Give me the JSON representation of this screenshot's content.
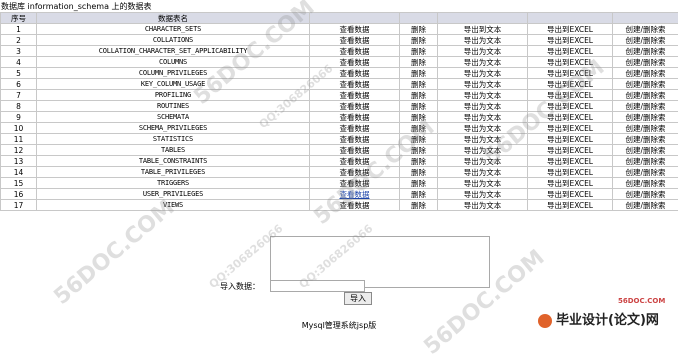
{
  "caption": "数据库 information_schema 上的数据表",
  "columns": [
    "序号",
    "数据表名",
    "",
    "",
    "",
    "",
    ""
  ],
  "actions": {
    "view": "查看数据",
    "delete": "删除",
    "export_text": "导出为文本",
    "export_excel": "导出到EXCEL",
    "create_delete": "创建/删除索"
  },
  "rows": [
    {
      "no": "1",
      "name": "CHARACTER_SETS",
      "export_text": "导出到文本",
      "export_excel": "导出到EXCEL"
    },
    {
      "no": "2",
      "name": "COLLATIONS",
      "export_text": "导出为文本",
      "export_excel": "导出到EXCEL"
    },
    {
      "no": "3",
      "name": "COLLATION_CHARACTER_SET_APPLICABILITY",
      "export_text": "导出为文本",
      "export_excel": "导出到EXCEL"
    },
    {
      "no": "4",
      "name": "COLUMNS",
      "export_text": "导出为文本",
      "export_excel": "导出到EXCEL"
    },
    {
      "no": "5",
      "name": "COLUMN_PRIVILEGES",
      "export_text": "导出为文本",
      "export_excel": "导出到EXCEL"
    },
    {
      "no": "6",
      "name": "KEY_COLUMN_USAGE",
      "export_text": "导出为文本",
      "export_excel": "导出到EXCEL"
    },
    {
      "no": "7",
      "name": "PROFILING",
      "export_text": "导出为文本",
      "export_excel": "导出到EXCEL"
    },
    {
      "no": "8",
      "name": "ROUTINES",
      "export_text": "导出为文本",
      "export_excel": "导出到EXCEL"
    },
    {
      "no": "9",
      "name": "SCHEMATA",
      "export_text": "导出为文本",
      "export_excel": "导出到EXCEL"
    },
    {
      "no": "10",
      "name": "SCHEMA_PRIVILEGES",
      "export_text": "导出为文本",
      "export_excel": "导出到EXCEL"
    },
    {
      "no": "11",
      "name": "STATISTICS",
      "export_text": "导出为文本",
      "export_excel": "导出到EXCEL"
    },
    {
      "no": "12",
      "name": "TABLES",
      "export_text": "导出为文本",
      "export_excel": "导出到EXCEL"
    },
    {
      "no": "13",
      "name": "TABLE_CONSTRAINTS",
      "export_text": "导出为文本",
      "export_excel": "导出到EXCEL"
    },
    {
      "no": "14",
      "name": "TABLE_PRIVILEGES",
      "export_text": "导出为文本",
      "export_excel": "导出到EXCEL"
    },
    {
      "no": "15",
      "name": "TRIGGERS",
      "export_text": "导出为文本",
      "export_excel": "导出到EXCEL"
    },
    {
      "no": "16",
      "name": "USER_PRIVILEGES",
      "export_text": "导出为文本",
      "export_excel": "导出到EXCEL"
    },
    {
      "no": "17",
      "name": "VIEWS",
      "export_text": "导出为文本",
      "export_excel": "导出到EXCEL"
    }
  ],
  "import": {
    "label": "导入数据：",
    "button": "导入"
  },
  "footer": "Mysql管理系统jsp版",
  "watermarks": [
    "56DOC.COM",
    "QQ:306826066"
  ],
  "brand": {
    "url": "56DOC.COM",
    "text": "毕业设计(论文)网"
  },
  "colors": {
    "header_bg": "#d9dbe6",
    "border": "#c8c8c8",
    "visited_link": "#1b43a8"
  }
}
